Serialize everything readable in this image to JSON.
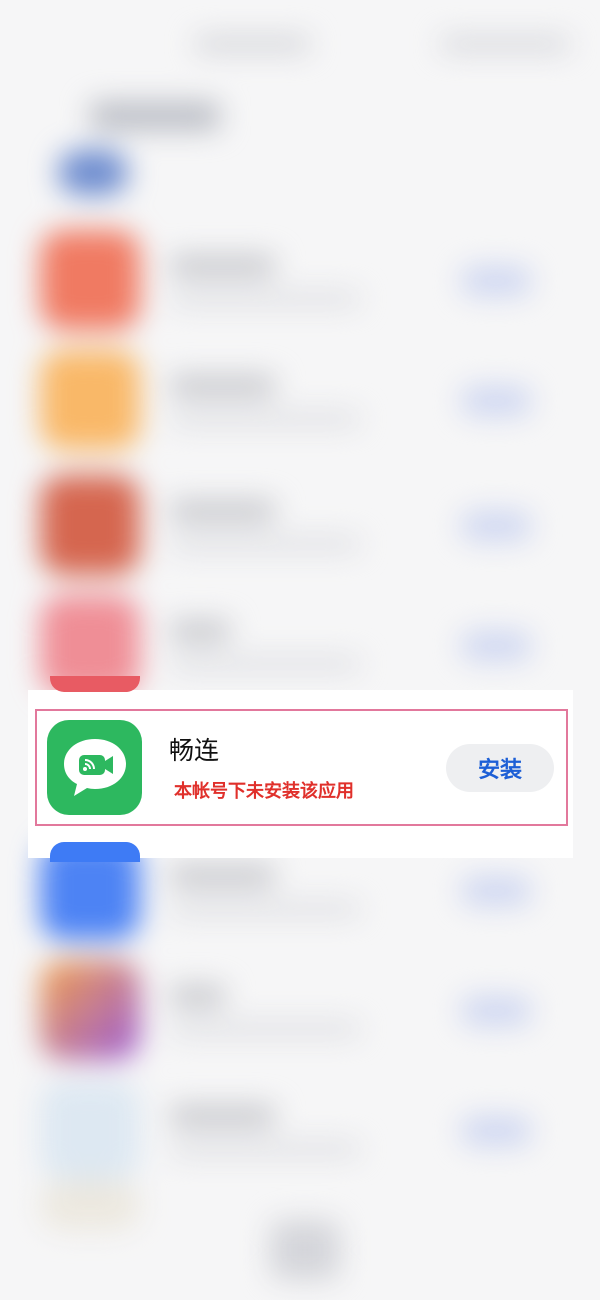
{
  "app": {
    "name": "畅连",
    "status_note": "本帐号下未安装该应用",
    "install_label": "安装",
    "icon": "video-chat-icon"
  },
  "colors": {
    "icon_green": "#2db85f",
    "status_red": "#e0302b",
    "install_blue": "#1d5fd6",
    "highlight_pink": "#e2789c"
  }
}
